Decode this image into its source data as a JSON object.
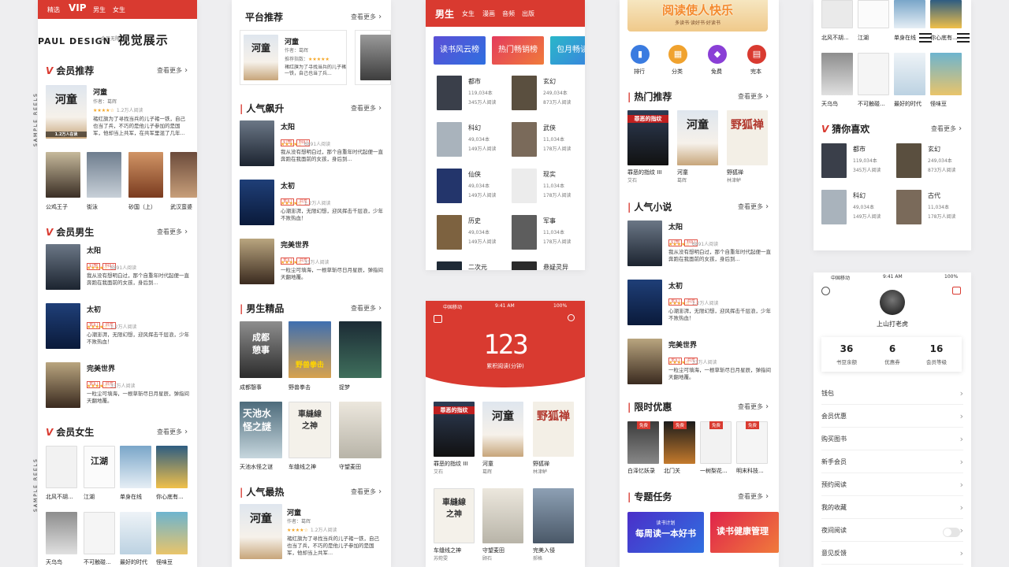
{
  "brand": {
    "name": "PAUL DESIGN",
    "title": "视觉展示",
    "sample_reels": "SAMPLE REELS",
    "year": "2018"
  },
  "colors": {
    "accent": "#d93a30",
    "star": "#f5a623"
  },
  "s1": {
    "tabs": [
      "精选",
      "VIP",
      "男生",
      "女生"
    ],
    "subtext": "会员无限畅读",
    "sections": [
      "会员推荐",
      "会员男生",
      "会员女生"
    ],
    "more": "查看更多",
    "rec": {
      "title": "河童",
      "author": "作者：葛辉",
      "reads": "1.2万人阅读",
      "desc": "褚红旗为了寻找当兵的儿子褚一铁，自己也当了兵，不巧的是他儿子参加的是国军，他却当上共军，在共军里混了几年...",
      "cover_text": "河童",
      "cover_sub": "1.2万人在读"
    },
    "row1": [
      "公鸡王子",
      "街泳",
      "砂国（上）",
      "武汉蛮婆"
    ],
    "male": [
      {
        "title": "太阳",
        "tags": [
          "幻想",
          "科幻"
        ],
        "reads": "6891人阅读",
        "desc": "我从没有想明白过，那个自重年时代起便一直奔跑在我面前的女孩，身后到..."
      },
      {
        "title": "太初",
        "tags": [
          "玄幻",
          "洪荒"
        ],
        "reads": "1.2万人阅读",
        "desc": "心潮澎湃，无限幻想，迎风挥击千层浪，少年不败热血！"
      },
      {
        "title": "完美世界",
        "tags": [
          "玄幻",
          "洪荒"
        ],
        "reads": "33万人阅读",
        "desc": "一粒尘可填海，一根草斩尽日月星辰，弹指间天翻地覆。"
      }
    ],
    "female1": [
      "北风不胡...",
      "江湖",
      "单身在线",
      "你心底有..."
    ],
    "female2": [
      "天乌鸟",
      "不可触碰...",
      "最好的时代",
      "怪味豆"
    ]
  },
  "s2": {
    "sections": [
      "平台推荐",
      "人气飙升",
      "男生精品",
      "人气最热"
    ],
    "more": "查看更多",
    "plat": {
      "title": "河童",
      "author": "作者：葛辉",
      "rating_label": "推荐指数：",
      "desc": "褚红旗为了寻找当兵的儿子褚一铁，自己也当了兵..."
    },
    "rise": [
      {
        "title": "太阳",
        "tags": [
          "幻想",
          "科幻"
        ],
        "reads": "6891人阅读",
        "desc": "我从没有想明白过，那个自重年时代起便一直奔跑在我面前的女孩，身后到..."
      },
      {
        "title": "太初",
        "tags": [
          "玄幻",
          "洪荒"
        ],
        "reads": "1.2万人阅读",
        "desc": "心潮澎湃，无限幻想，迎风挥击千层浪，少年不败热血！"
      },
      {
        "title": "完美世界",
        "tags": [
          "玄幻",
          "洪荒"
        ],
        "reads": "33万人阅读",
        "desc": "一粒尘可填海，一根草斩尽日月星辰，弹指间天翻地覆。"
      }
    ],
    "male1": [
      "成都憩事",
      "野兽拳击",
      "捉梦"
    ],
    "male2": [
      "天池水怪之谜",
      "车缝线之神",
      "守望麦田"
    ],
    "hot": {
      "title": "河童",
      "author": "作者：葛辉",
      "reads": "1.2万人阅读",
      "desc": "褚红旗为了寻找当兵的儿子褚一铁，自己也当了兵，不巧的是他儿子参加的是国军，他却当上共军..."
    }
  },
  "s3": {
    "tabs": [
      "男生",
      "女生",
      "漫画",
      "音频",
      "出版"
    ],
    "banners": [
      "读书风云榜",
      "热门畅销榜",
      "包月畅读"
    ],
    "cats": [
      {
        "name": "都市",
        "count": "119,034本",
        "reads": "345万人阅读"
      },
      {
        "name": "玄幻",
        "count": "249,034本",
        "reads": "873万人阅读"
      },
      {
        "name": "科幻",
        "count": "49,034本",
        "reads": "149万人阅读"
      },
      {
        "name": "武侠",
        "count": "11,034本",
        "reads": "178万人阅读"
      },
      {
        "name": "仙侠",
        "count": "49,034本",
        "reads": "149万人阅读"
      },
      {
        "name": "现实",
        "count": "11,034本",
        "reads": "178万人阅读"
      },
      {
        "name": "历史",
        "count": "49,034本",
        "reads": "149万人阅读"
      },
      {
        "name": "军事",
        "count": "11,034本",
        "reads": "178万人阅读"
      },
      {
        "name": "二次元",
        "count": "",
        "reads": ""
      },
      {
        "name": "悬疑灵异",
        "count": "",
        "reads": ""
      }
    ]
  },
  "s4": {
    "status": {
      "carrier": "中国移动",
      "time": "9:41 AM",
      "battery": "100%"
    },
    "minutes": "123",
    "minutes_label": "累积阅读(分钟)",
    "books1": [
      {
        "title": "罪恶的指纹 III",
        "author": "艾石"
      },
      {
        "title": "河童",
        "author": "葛辉"
      },
      {
        "title": "野狐禅",
        "author": "林津鲈"
      }
    ],
    "books2": [
      {
        "title": "车缝线之神",
        "author": "苏菀雯"
      },
      {
        "title": "守望麦田",
        "author": "顾石"
      },
      {
        "title": "完美入侵",
        "author": "郝格"
      }
    ]
  },
  "s5": {
    "banner": "阅读使人快乐",
    "banner_sub": "多读书·读好书·好读书",
    "icons": [
      "排行",
      "分类",
      "免费",
      "完本"
    ],
    "sections": [
      "热门推荐",
      "人气小说",
      "限时优惠",
      "专题任务"
    ],
    "more": "查看更多",
    "hot": [
      {
        "title": "罪恶的指纹 III",
        "author": "艾石"
      },
      {
        "title": "河童",
        "author": "葛辉"
      },
      {
        "title": "野狐禅",
        "author": "林津鲈"
      }
    ],
    "novels": [
      {
        "title": "太阳",
        "tags": [
          "幻想",
          "科幻"
        ],
        "reads": "6891人阅读",
        "desc": "我从没有想明白过，那个自重年时代起便一直奔跑在我面前的女孩，身后到..."
      },
      {
        "title": "太初",
        "tags": [
          "玄幻",
          "洪荒"
        ],
        "reads": "1.2万人阅读",
        "desc": "心潮澎湃，无限幻想，迎风挥击千层浪，少年不败热血！"
      },
      {
        "title": "完美世界",
        "tags": [
          "玄幻",
          "洪荒"
        ],
        "reads": "33万人阅读",
        "desc": "一粒尘可填海，一根草斩尽日月星辰，弹指间天翻地覆。"
      }
    ],
    "deals": [
      "白泽忆妖录",
      "北门关",
      "一树梨花...",
      "明末科技..."
    ],
    "deal_badge": "免费",
    "topics": [
      "每周读一本好书",
      "读书健康管理"
    ],
    "topic_sub": "读书计划"
  },
  "s6": {
    "row1": [
      "北风不胡...",
      "江湖",
      "单身在线",
      "你心底有..."
    ],
    "row2": [
      "天乌鸟",
      "不可触碰...",
      "最好的时代",
      "怪味豆"
    ],
    "section": "猜你喜欢",
    "more": "查看更多",
    "cats": [
      {
        "name": "都市",
        "count": "119,034本",
        "reads": "345万人阅读"
      },
      {
        "name": "玄幻",
        "count": "249,034本",
        "reads": "873万人阅读"
      },
      {
        "name": "科幻",
        "count": "49,034本",
        "reads": "149万人阅读"
      },
      {
        "name": "古代",
        "count": "11,034本",
        "reads": "178万人阅读"
      }
    ]
  },
  "s7": {
    "status": {
      "carrier": "中国移动",
      "time": "9:41 AM",
      "battery": "100%"
    },
    "username": "上山打老虎",
    "stats": [
      {
        "value": "36",
        "label": "书豆余额"
      },
      {
        "value": "6",
        "label": "优惠券"
      },
      {
        "value": "16",
        "label": "会员等级"
      }
    ],
    "menu": [
      "钱包",
      "会员优惠",
      "购买图书",
      "新手会员",
      "预约阅读",
      "我的收藏",
      "夜间阅读",
      "意见反馈"
    ]
  }
}
